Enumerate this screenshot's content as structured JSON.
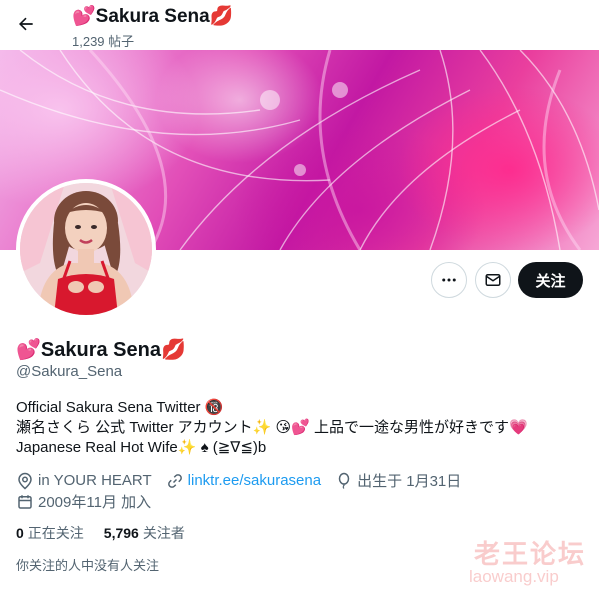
{
  "header": {
    "title": "💕Sakura Sena💋",
    "post_count": "1,239 帖子"
  },
  "profile": {
    "display_name": "💕Sakura Sena💋",
    "handle": "@Sakura_Sena",
    "bio_lines": [
      "Official Sakura Sena Twitter 🔞",
      "瀬名さくら 公式 Twitter アカウント✨ 😘💕 上品で一途な男性が好きです💗",
      "Japanese Real Hot Wife✨ ♠ (≧∇≦)b"
    ],
    "location": "in YOUR HEART",
    "website": "linktr.ee/sakurasena",
    "birthday": "出生于 1月31日",
    "joined": "2009年11月 加入"
  },
  "stats": {
    "following_count": "0",
    "following_label": "正在关注",
    "followers_count": "5,796",
    "followers_label": "关注者"
  },
  "followed_by_text": "你关注的人中没有人关注",
  "buttons": {
    "follow_label": "关注"
  },
  "icons": {
    "back": "arrow-left-icon",
    "more": "more-dots-icon",
    "message": "envelope-icon",
    "location": "location-pin-icon",
    "link": "link-icon",
    "birthday": "balloon-icon",
    "joined": "calendar-icon"
  },
  "watermark": {
    "line1": "老王论坛",
    "line2": "laowang.vip"
  },
  "colors": {
    "link": "#1d9bf0",
    "secondary_text": "#536471",
    "follow_button": "#0f1419"
  }
}
